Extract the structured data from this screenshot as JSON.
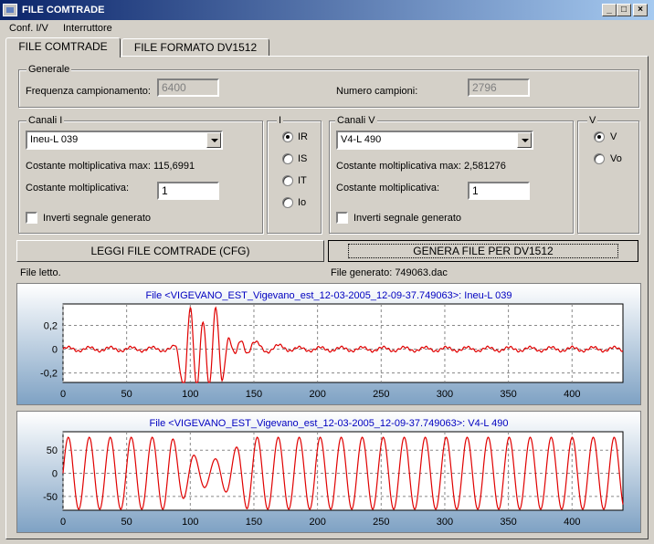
{
  "window": {
    "title": "FILE COMTRADE"
  },
  "menu": [
    "Conf. I/V",
    "Interruttore"
  ],
  "tabs": [
    "FILE COMTRADE",
    "FILE FORMATO DV1512"
  ],
  "generale": {
    "title": "Generale",
    "freq_label": "Frequenza campionamento:",
    "freq_value": "6400",
    "campioni_label": "Numero campioni:",
    "campioni_value": "2796"
  },
  "canali_i": {
    "title": "Canali  I",
    "selected": "Ineu-L 039",
    "max_label": "Costante moltiplicativa max: 115,6991",
    "mult_label": "Costante moltiplicativa:",
    "mult_value": "1",
    "invert_label": "Inverti segnale generato"
  },
  "i_group": {
    "title": "I",
    "options": [
      "IR",
      "IS",
      "IT",
      "Io"
    ],
    "selected": 0
  },
  "canali_v": {
    "title": "Canali V",
    "selected": "V4-L 490",
    "max_label": "Costante moltiplicativa max: 2,581276",
    "mult_label": "Costante moltiplicativa:",
    "mult_value": "1",
    "invert_label": "Inverti segnale generato"
  },
  "v_group": {
    "title": "V",
    "options": [
      "V",
      "Vo"
    ],
    "selected": 0
  },
  "buttons": {
    "read": "LEGGI  FILE COMTRADE (CFG)",
    "generate": "GENERA FILE PER DV1512"
  },
  "status": {
    "read": "File letto.",
    "generated": "File generato: 749063.dac"
  },
  "colors": {
    "signal": "#e00000",
    "title_text": "#0000c0"
  },
  "chart_data": [
    {
      "type": "line",
      "title": "File <VIGEVANO_EST_Vigevano_est_12-03-2005_12-09-37.749063>: Ineu-L 039",
      "xlim": [
        0,
        440
      ],
      "ylim": [
        -0.28,
        0.38
      ],
      "xticks": [
        0,
        50,
        100,
        150,
        200,
        250,
        300,
        350,
        400
      ],
      "xtick_labels": [
        "0",
        "50",
        "100",
        "150",
        "200",
        "250",
        "300",
        "350",
        "400"
      ],
      "yticks": [
        0.2,
        0,
        -0.2
      ],
      "ytick_labels": [
        "0,2",
        "0",
        "-0,2"
      ],
      "series": [
        {
          "x": [
            0,
            85,
            88,
            95,
            100,
            105,
            110,
            115,
            120,
            125,
            130,
            135,
            140,
            145,
            150,
            160,
            170,
            180,
            440
          ],
          "y": [
            0,
            0,
            0.02,
            -0.3,
            0.34,
            -0.33,
            0.25,
            -0.3,
            0.33,
            -0.25,
            0.1,
            -0.05,
            0.07,
            -0.02,
            0.05,
            -0.01,
            0.02,
            0,
            0
          ]
        }
      ]
    },
    {
      "type": "line",
      "title": "File <VIGEVANO_EST_Vigevano_est_12-03-2005_12-09-37.749063>: V4-L 490",
      "xlim": [
        0,
        440
      ],
      "ylim": [
        -80,
        90
      ],
      "xticks": [
        0,
        50,
        100,
        150,
        200,
        250,
        300,
        350,
        400
      ],
      "xtick_labels": [
        "0",
        "50",
        "100",
        "150",
        "200",
        "250",
        "300",
        "350",
        "400"
      ],
      "yticks": [
        50,
        0,
        -50
      ],
      "ytick_labels": [
        "50",
        "0",
        "-50"
      ],
      "series": [
        {
          "period": 16.5,
          "amplitude": 78,
          "dip_range": [
            85,
            145
          ],
          "dip_amplitude": 30
        }
      ]
    }
  ]
}
